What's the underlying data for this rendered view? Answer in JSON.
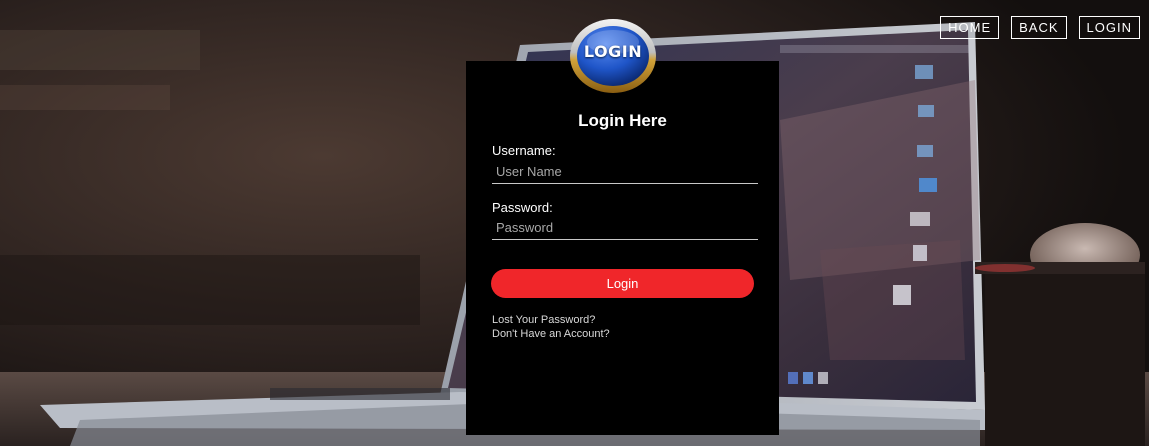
{
  "nav": {
    "home_label": "HOME",
    "back_label": "BACK",
    "login_label": "LOGIN"
  },
  "logo": {
    "text": "LOGIN"
  },
  "form": {
    "title": "Login Here",
    "username_label": "Username:",
    "username_placeholder": "User Name",
    "password_label": "Password:",
    "password_placeholder": "Password",
    "submit_label": "Login",
    "lost_password_link": "Lost Your Password?",
    "no_account_link": "Don't Have an Account?"
  },
  "colors": {
    "card_background": "#000000",
    "button_accent": "#f0262a",
    "logo_blue": "#1f55c8",
    "logo_gold": "#d2a33a"
  },
  "icons": {
    "background": "laptop-background-image"
  }
}
